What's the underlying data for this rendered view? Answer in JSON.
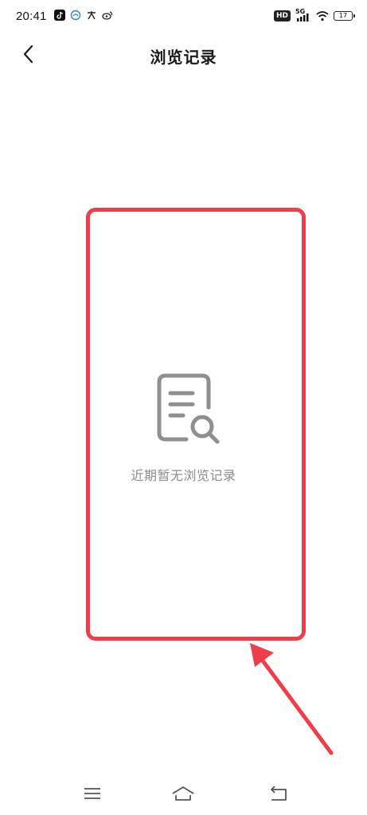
{
  "status_bar": {
    "time": "20:41",
    "hd_label": "HD",
    "network_label": "5G",
    "battery_level": "17"
  },
  "header": {
    "title": "浏览记录"
  },
  "empty_state": {
    "message": "近期暂无浏览记录"
  },
  "colors": {
    "highlight": "#ef3e4a",
    "icon_gray": "#8f8f8f",
    "text_gray": "#8c8c8c"
  },
  "icons": {
    "back": "chevron-left-icon",
    "empty": "document-search-icon",
    "nav_menu": "menu-icon",
    "nav_home": "home-icon",
    "nav_back": "back-icon"
  }
}
